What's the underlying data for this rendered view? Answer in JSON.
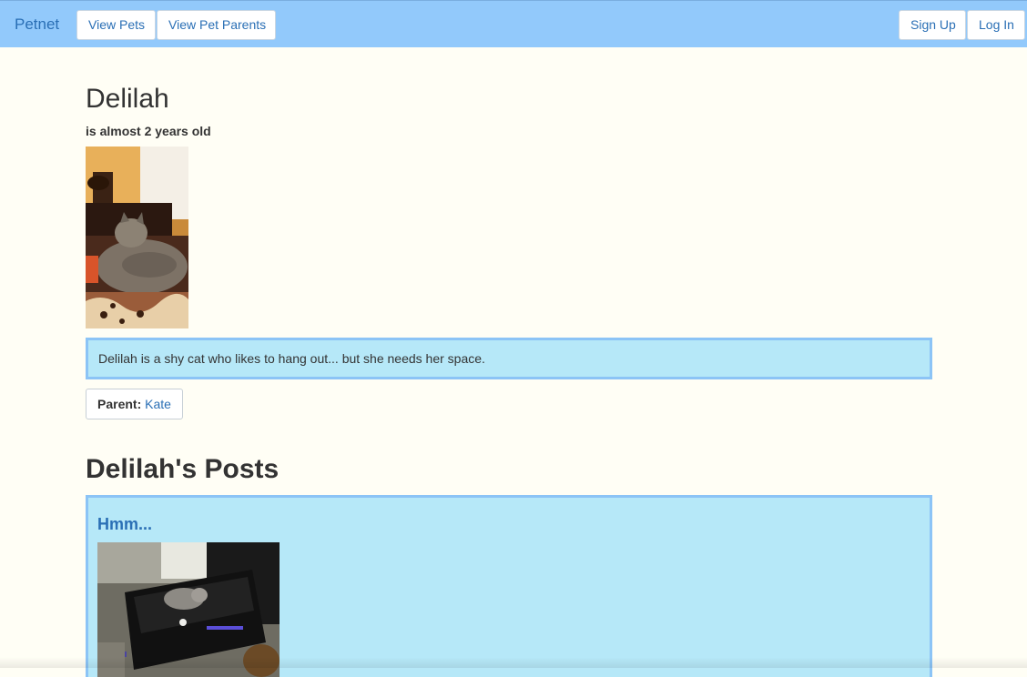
{
  "navbar": {
    "brand": "Petnet",
    "view_pets": "View Pets",
    "view_pet_parents": "View Pet Parents",
    "sign_up": "Sign Up",
    "log_in": "Log In"
  },
  "pet": {
    "name": "Delilah",
    "age_text": "is almost 2 years old",
    "bio": "Delilah is a shy cat who likes to hang out... but she needs her space.",
    "parent_label": "Parent:",
    "parent_name": "Kate"
  },
  "posts": {
    "heading": "Delilah's Posts",
    "items": [
      {
        "title": "Hmm..."
      }
    ]
  },
  "colors": {
    "navbar_bg": "#92c9fb",
    "page_bg": "#fffef5",
    "link": "#2a6fb5",
    "box_bg": "#b6e8f8",
    "box_border": "#8cc4f6"
  }
}
